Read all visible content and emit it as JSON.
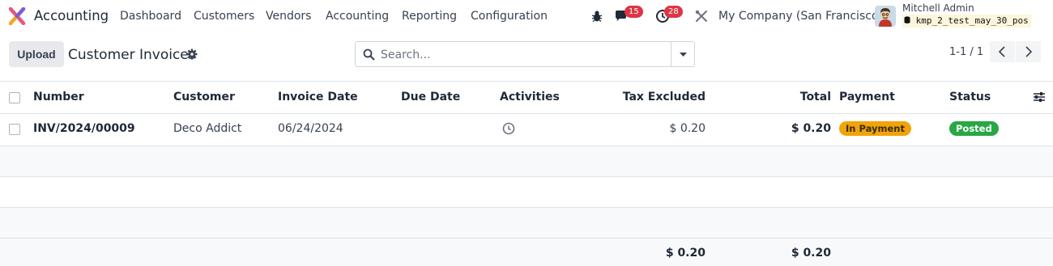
{
  "navbar": {
    "app_name": "Accounting",
    "menu": [
      "Dashboard",
      "Customers",
      "Vendors",
      "Accounting",
      "Reporting",
      "Configuration"
    ],
    "messages_count": "15",
    "activities_count": "28",
    "company": "My Company (San Francisco)",
    "user_name": "Mitchell Admin",
    "database": "kmp_2_test_may_30_pos"
  },
  "control_panel": {
    "upload_label": "Upload",
    "title": "Customer Invoices",
    "search_placeholder": "Search...",
    "pager": "1-1 / 1"
  },
  "table": {
    "columns": [
      "Number",
      "Customer",
      "Invoice Date",
      "Due Date",
      "Activities",
      "Tax Excluded",
      "Total",
      "Payment",
      "Status"
    ],
    "rows": [
      {
        "number": "INV/2024/00009",
        "customer": "Deco Addict",
        "invoice_date": "06/24/2024",
        "due_date": "",
        "tax_excluded": "$ 0.20",
        "total": "$ 0.20",
        "payment": "In Payment",
        "status": "Posted"
      }
    ],
    "footer": {
      "tax_excluded": "$ 0.20",
      "total": "$ 0.20"
    }
  },
  "colors": {
    "payment_badge": "#f0a30a",
    "status_badge": "#28a745",
    "notification_badge": "#dc3545"
  }
}
